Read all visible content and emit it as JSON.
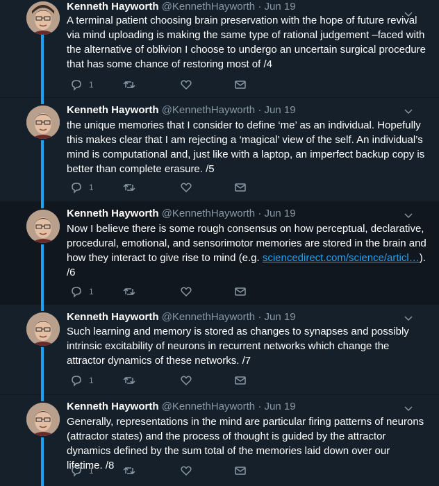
{
  "author": {
    "name": "Kenneth Hayworth",
    "handle": "@KennethHayworth",
    "dot": "·"
  },
  "colors": {
    "background": "#15202b",
    "highlight_background": "#10171e",
    "thread_line": "#1da1f2",
    "secondary_text": "#8899a6",
    "link": "#1da1f2"
  },
  "tweets": [
    {
      "date": "Jun 19",
      "text": "A terminal patient choosing brain preservation with the hope of future revival via mind uploading is making the same type of rational judgement –faced with the alternative of oblivion I choose to undergo an uncertain surgical procedure that has some chance of restoring most of /4",
      "reply_count": "1"
    },
    {
      "date": "Jun 19",
      "text": "the unique memories that I consider to define ‘me’ as an individual. Hopefully this makes clear that I am rejecting a ‘magical’ view of the self. An individual’s mind is computational and, just like with a laptop, an imperfect backup copy is better than complete erasure. /5",
      "reply_count": "1"
    },
    {
      "date": "Jun 19",
      "text_before_link": "Now I believe there is some rough consensus on how perceptual, declarative, procedural, emotional, and sensorimotor memories are stored in the brain and how they interact to give rise to mind (e.g. ",
      "link_text": "sciencedirect.com/science/articl…",
      "text_after_link": "). /6",
      "reply_count": "1"
    },
    {
      "date": "Jun 19",
      "text": "Such learning and memory is stored as changes to synapses and possibly intrinsic excitability of neurons in recurrent networks which change the attractor dynamics of these networks. /7",
      "reply_count": "1"
    },
    {
      "date": "Jun 19",
      "text": "Generally, representations in the mind are particular firing patterns of neurons (attractor states) and the process of thought is guided by the attractor dynamics defined by the sum total of the memories laid down over our lifetime. /8",
      "reply_count": "1"
    }
  ],
  "icons": {
    "reply": "reply-icon",
    "retweet": "retweet-icon",
    "like": "heart-icon",
    "dm": "envelope-icon",
    "menu": "chevron-down-icon"
  }
}
